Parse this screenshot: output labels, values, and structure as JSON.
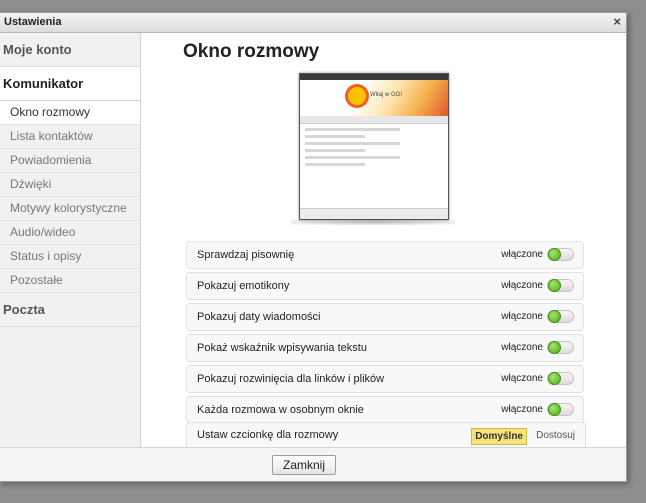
{
  "window": {
    "title": "Ustawienia",
    "close_glyph": "×"
  },
  "sidebar": {
    "sections": [
      {
        "label": "Moje konto",
        "active": false
      },
      {
        "label": "Komunikator",
        "active": true
      },
      {
        "label": "Poczta",
        "active": false
      }
    ],
    "items": [
      {
        "label": "Okno rozmowy",
        "active": true
      },
      {
        "label": "Lista kontaktów",
        "active": false
      },
      {
        "label": "Powiadomienia",
        "active": false
      },
      {
        "label": "Dźwięki",
        "active": false
      },
      {
        "label": "Motywy kolorystyczne",
        "active": false
      },
      {
        "label": "Audio/wideo",
        "active": false
      },
      {
        "label": "Status i opisy",
        "active": false
      },
      {
        "label": "Pozostałe",
        "active": false
      }
    ]
  },
  "main": {
    "title": "Okno rozmowy",
    "preview": {
      "welcome_text": "Witaj w GG!"
    },
    "settings": [
      {
        "label": "Sprawdzaj pisownię",
        "state": "włączone",
        "on": true
      },
      {
        "label": "Pokazuj emotikony",
        "state": "włączone",
        "on": true
      },
      {
        "label": "Pokazuj daty wiadomości",
        "state": "włączone",
        "on": true
      },
      {
        "label": "Pokaż wskaźnik wpisywania tekstu",
        "state": "włączone",
        "on": true
      },
      {
        "label": "Pokazuj rozwinięcia dla linków i plików",
        "state": "włączone",
        "on": true
      },
      {
        "label": "Każda rozmowa w osobnym oknie",
        "state": "włączone",
        "on": true
      }
    ],
    "font_row": {
      "label": "Ustaw czcionkę dla rozmowy",
      "default_button": "Domyślne",
      "custom_button": "Dostosuj"
    }
  },
  "footer": {
    "close_button": "Zamknij"
  },
  "colors": {
    "toggle_on": "#4fae1a",
    "default_button_bg": "#f7e37a",
    "backdrop": "#8e8e8e"
  },
  "icons": {
    "window_close": "close-icon",
    "preview_logo": "gg-sun-icon"
  }
}
